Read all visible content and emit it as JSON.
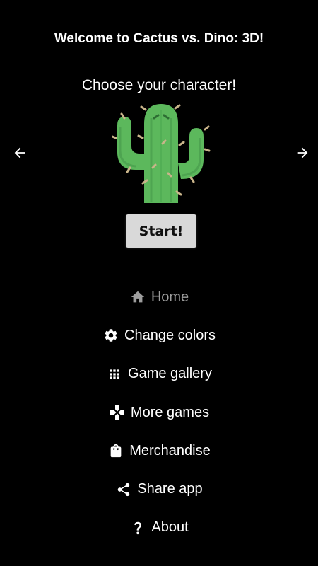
{
  "header": {
    "welcome": "Welcome to Cactus vs. Dino: 3D!",
    "choose": "Choose your character!"
  },
  "character": {
    "name": "cactus",
    "colors": {
      "body": "#5cb85c",
      "dark": "#3f8f45",
      "spikes": "#c9b48a"
    }
  },
  "start_label": "Start!",
  "menu": [
    {
      "label": "Home",
      "icon": "home-icon",
      "active": true
    },
    {
      "label": "Change colors",
      "icon": "gear-icon",
      "active": false
    },
    {
      "label": "Game gallery",
      "icon": "grid-icon",
      "active": false
    },
    {
      "label": "More games",
      "icon": "gamepad-icon",
      "active": false
    },
    {
      "label": "Merchandise",
      "icon": "shopping-bag-icon",
      "active": false
    },
    {
      "label": "Share app",
      "icon": "share-icon",
      "active": false
    },
    {
      "label": "About",
      "icon": "question-icon",
      "active": false
    }
  ],
  "colors": {
    "background": "#000000",
    "text": "#ffffff",
    "active_menu": "#9e9e9e",
    "button_bg": "#d9d9d9"
  }
}
